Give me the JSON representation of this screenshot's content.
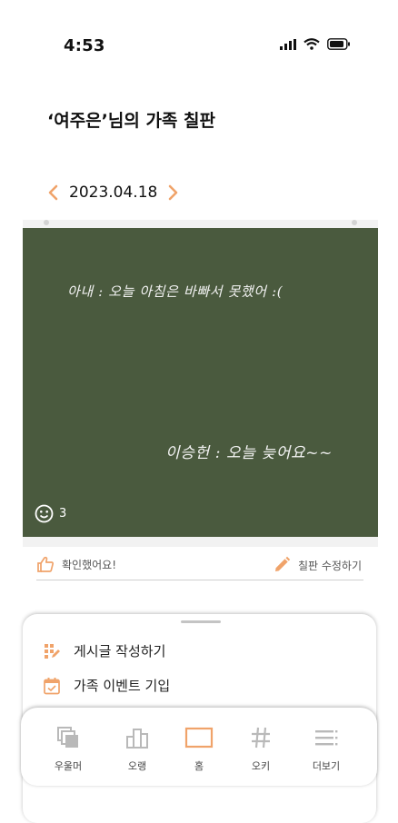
{
  "status": {
    "time": "4:53"
  },
  "page": {
    "title": "‘여주은’님의 가족 칠판"
  },
  "date_nav": {
    "date": "2023.04.18"
  },
  "board": {
    "messages": [
      "아내 : 오늘 아침은 바빠서 못했어 :(",
      "이승헌 : 오늘 늦어요~~"
    ],
    "reaction_count": "3"
  },
  "actions": {
    "confirm_label": "확인했어요!",
    "edit_label": "칠판 수정하기"
  },
  "sheet": {
    "items": [
      {
        "label": "게시글 작성하기"
      },
      {
        "label": "가족 이벤트 기입"
      }
    ]
  },
  "tabbar": {
    "items": [
      {
        "label": "우울머"
      },
      {
        "label": "오랭"
      },
      {
        "label": "홈"
      },
      {
        "label": "오키"
      },
      {
        "label": "더보기"
      }
    ]
  },
  "colors": {
    "accent": "#f0a36a",
    "board": "#4a5a3e",
    "inactive_icon": "#b9b9b9"
  }
}
